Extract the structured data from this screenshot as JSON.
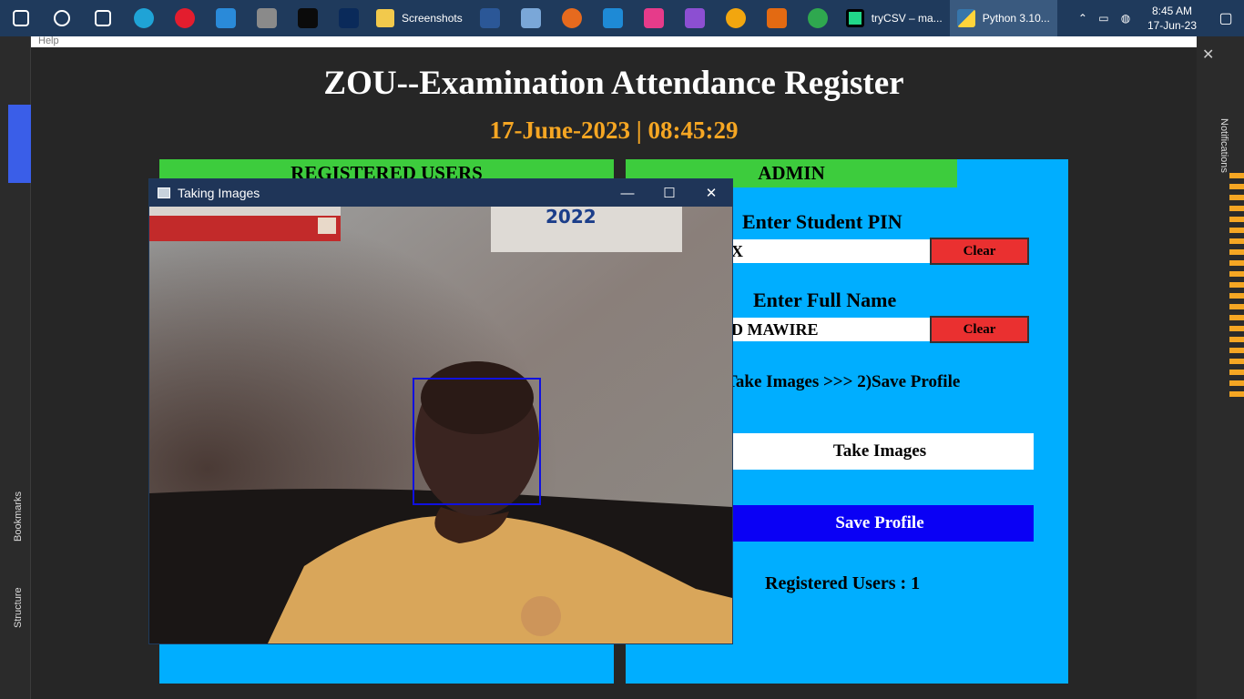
{
  "taskbar": {
    "apps": [
      {
        "icon": "start-icon",
        "color": "#ffffff"
      },
      {
        "icon": "search-icon",
        "color": "#ffffff"
      },
      {
        "icon": "task-view-icon",
        "color": "#ffffff"
      },
      {
        "icon": "edge-icon",
        "color": "#1fa3d6"
      },
      {
        "icon": "opera-icon",
        "color": "#e31d2e"
      },
      {
        "icon": "ie-icon",
        "color": "#2a8ad9"
      },
      {
        "icon": "camera-icon",
        "color": "#8a8a8a"
      },
      {
        "icon": "terminal-icon",
        "color": "#0b0b0b"
      },
      {
        "icon": "visual-studio-icon",
        "color": "#0a2a5a"
      }
    ],
    "screenshots_label": "Screenshots",
    "apps2": [
      {
        "icon": "word-icon",
        "color": "#2b5797"
      },
      {
        "icon": "box-icon",
        "color": "#7aa7d8"
      },
      {
        "icon": "firefox-icon",
        "color": "#e66a1e"
      },
      {
        "icon": "vscode-icon",
        "color": "#1e8ad6"
      },
      {
        "icon": "app-icon",
        "color": "#e63b8a"
      },
      {
        "icon": "vs-purple-icon",
        "color": "#8c4fd2"
      },
      {
        "icon": "ubuntu-icon",
        "color": "#f2a60f"
      },
      {
        "icon": "sublime-icon",
        "color": "#e36a12"
      },
      {
        "icon": "chrome-icon",
        "color": "#2fa84f"
      }
    ],
    "pycharm_label": "tryCSV – ma...",
    "python_label": "Python 3.10...",
    "time": "8:45 AM",
    "date": "17-Jun-23"
  },
  "help_menu": "Help",
  "app": {
    "title": "ZOU--Examination Attendance Register",
    "datetime": "17-June-2023  |  08:45:29",
    "registered_header": "REGISTERED USERS",
    "admin_header": "ADMIN",
    "pin_label": "Enter Student PIN",
    "pin_value": "X",
    "name_label": "Enter Full Name",
    "name_value": "D MAWIRE",
    "clear_label": "Clear",
    "steps_text": "Take Images  >>>  2)Save Profile",
    "take_images_label": "Take Images",
    "save_profile_label": "Save Profile",
    "registered_count": "Registered Users   : 1"
  },
  "camera_window": {
    "title": "Taking Images",
    "calendar_year": "2022"
  },
  "colors": {
    "frame_blue": "#00aeff",
    "header_green": "#3dcc3d",
    "clear_red": "#ea3030",
    "save_blue": "#0a00f5",
    "date_orange": "#f5a623"
  }
}
